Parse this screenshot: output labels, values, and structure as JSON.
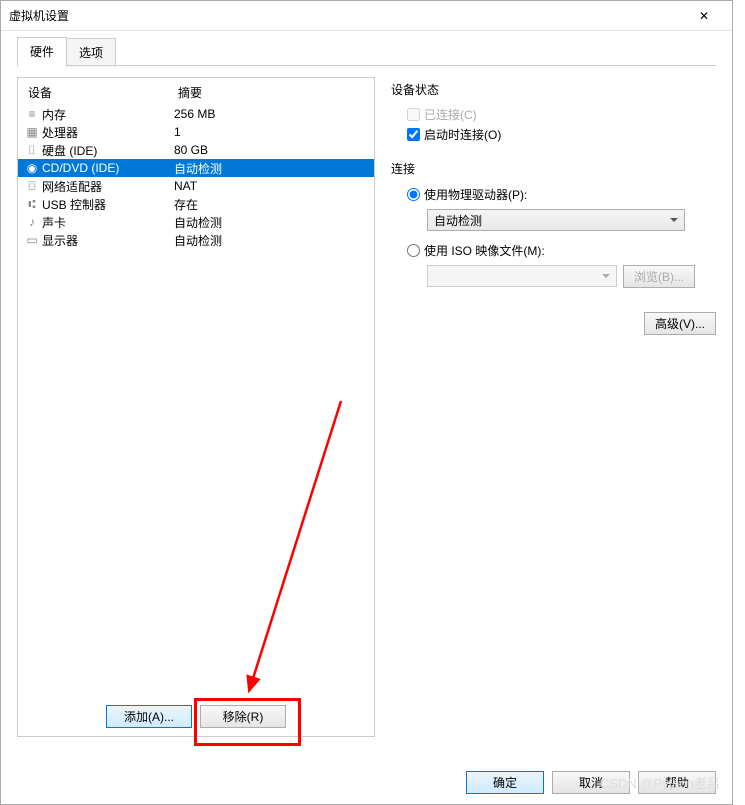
{
  "window": {
    "title": "虚拟机设置",
    "close_icon": "✕"
  },
  "tabs": {
    "hardware": "硬件",
    "options": "选项"
  },
  "columns": {
    "device": "设备",
    "summary": "摘要"
  },
  "devices": [
    {
      "icon": "≡",
      "name": "内存",
      "summary": "256 MB"
    },
    {
      "icon": "▦",
      "name": "处理器",
      "summary": "1"
    },
    {
      "icon": "⌷",
      "name": "硬盘 (IDE)",
      "summary": "80 GB"
    },
    {
      "icon": "◉",
      "name": "CD/DVD (IDE)",
      "summary": "自动检测",
      "selected": true
    },
    {
      "icon": "⌼",
      "name": "网络适配器",
      "summary": "NAT"
    },
    {
      "icon": "⑆",
      "name": "USB 控制器",
      "summary": "存在"
    },
    {
      "icon": "♪",
      "name": "声卡",
      "summary": "自动检测"
    },
    {
      "icon": "▭",
      "name": "显示器",
      "summary": "自动检测"
    }
  ],
  "status": {
    "title": "设备状态",
    "connected": "已连接(C)",
    "connect_on_start": "启动时连接(O)"
  },
  "connection": {
    "title": "连接",
    "physical": "使用物理驱动器(P):",
    "physical_value": "自动检测",
    "iso": "使用 ISO 映像文件(M):",
    "browse": "浏览(B)..."
  },
  "advanced": "高级(V)...",
  "buttons": {
    "add": "添加(A)...",
    "remove": "移除(R)",
    "ok": "确定",
    "cancel": "取消",
    "help": "帮助"
  },
  "watermark": "CSDN @Python老吕"
}
